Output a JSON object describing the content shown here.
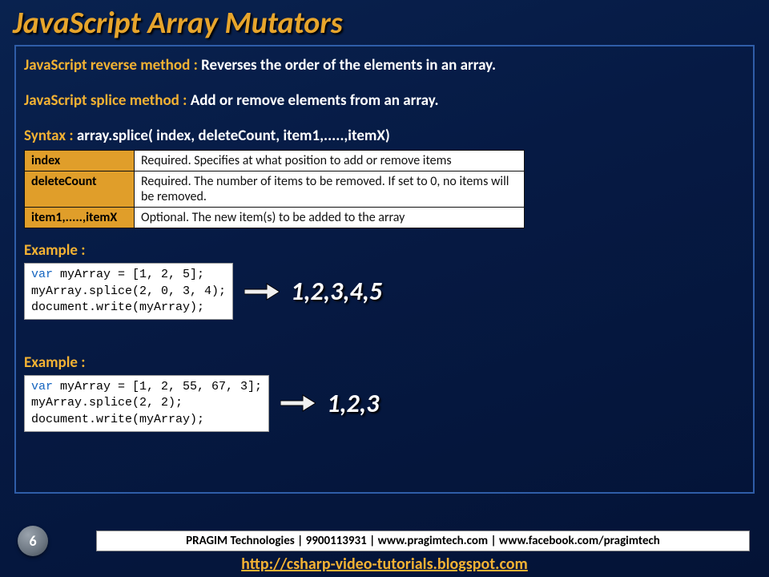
{
  "title": "JavaScript Array Mutators",
  "reverse": {
    "label": "JavaScript reverse method : ",
    "desc": "Reverses the order of the elements in an array."
  },
  "splice": {
    "label": "JavaScript splice method : ",
    "desc": "Add or remove elements from an array."
  },
  "syntax": {
    "label": "Syntax : ",
    "code": "array.splice( index, deleteCount, item1,.....,itemX)"
  },
  "params": [
    {
      "name": "index",
      "desc": "Required. Specifies at what position to add or remove items"
    },
    {
      "name": "deleteCount",
      "desc": "Required. The number of items to be removed. If set to 0, no items will be removed."
    },
    {
      "name": "item1,.....,itemX",
      "desc": "Optional. The new item(s) to be added to the array"
    }
  ],
  "ex1": {
    "heading": "Example :",
    "code_rest": " myArray = [1, 2, 5];\nmyArray.splice(2, 0, 3, 4);\ndocument.write(myArray);",
    "output": "1,2,3,4,5"
  },
  "ex2": {
    "heading": "Example :",
    "code_rest": " myArray = [1, 2, 55, 67, 3];\nmyArray.splice(2, 2);\ndocument.write(myArray);",
    "output": "1,2,3"
  },
  "footer": "PRAGIM Technologies | 9900113931 | www.pragimtech.com | www.facebook.com/pragimtech",
  "link": "http://csharp-video-tutorials.blogspot.com",
  "page": "6",
  "var_kw": "var"
}
